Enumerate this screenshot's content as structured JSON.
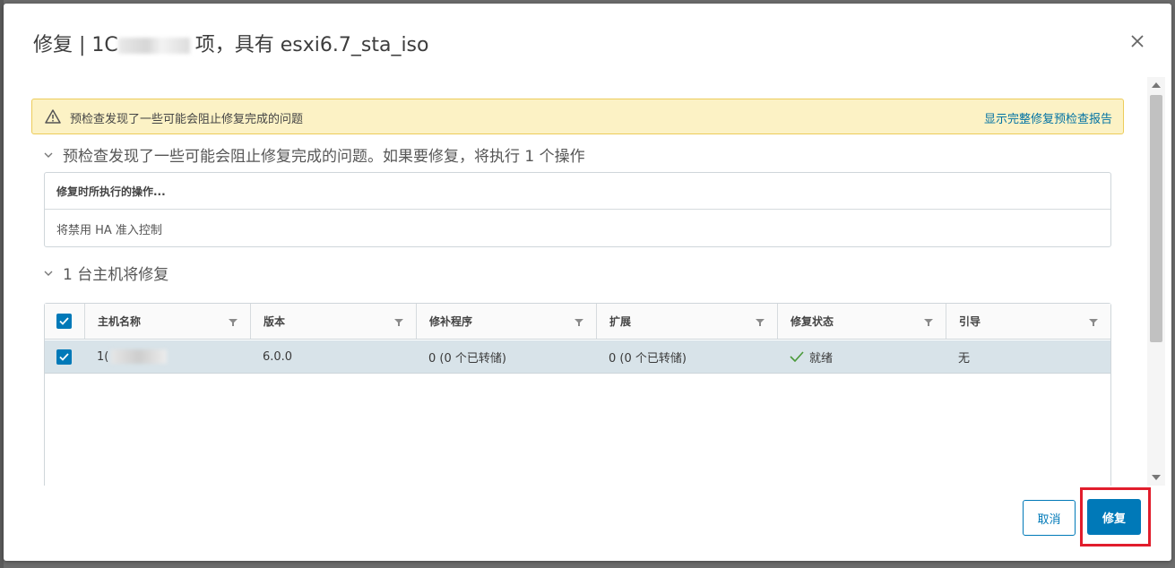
{
  "dialog": {
    "title_prefix": "修复 | 1C",
    "title_suffix": "项，具有 esxi6.7_sta_iso"
  },
  "alert": {
    "text": "预检查发现了一些可能会阻止修复完成的问题",
    "link": "显示完整修复预检查报告",
    "colors": {
      "background": "#fcf2c5",
      "border": "#eccc5a",
      "link": "#0072a3"
    }
  },
  "operations_section": {
    "header": "预检查发现了一些可能会阻止修复完成的问题。如果要修复，将执行 1 个操作",
    "table_header": "修复时所执行的操作...",
    "rows": [
      "将禁用 HA 准入控制"
    ]
  },
  "hosts_section": {
    "header": "1 台主机将修复",
    "columns": [
      "主机名称",
      "版本",
      "修补程序",
      "扩展",
      "修复状态",
      "引导"
    ],
    "rows": [
      {
        "selected": true,
        "host": "1(",
        "version": "6.0.0",
        "patches": "0 (0 个已转储)",
        "extensions": "0 (0 个已转储)",
        "status": "就绪",
        "boot": "无"
      }
    ]
  },
  "footer": {
    "cancel": "取消",
    "remediate": "修复",
    "primary_color": "#0079b8",
    "highlight_color": "#e11d2c"
  },
  "icons": [
    "close-icon",
    "warning-icon",
    "chevron-down-icon",
    "filter-icon",
    "checkbox-icon",
    "check-icon"
  ]
}
